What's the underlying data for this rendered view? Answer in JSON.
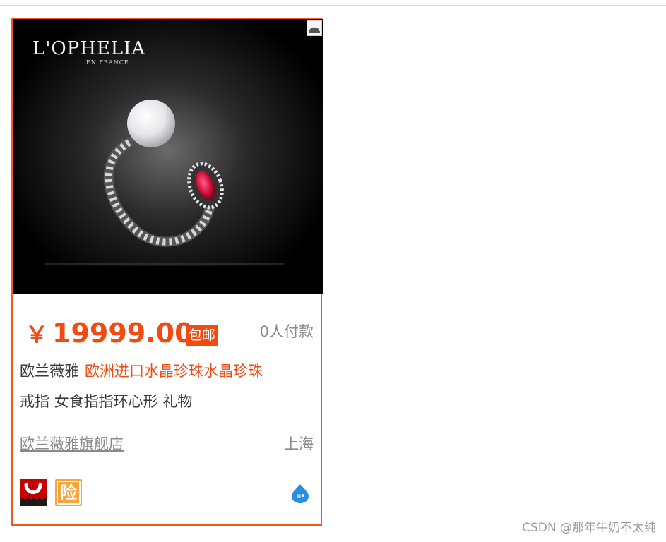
{
  "product": {
    "brand_logo_text": "L'OPHELIA",
    "brand_logo_subtext": "EN FRANCE",
    "price_currency": "￥",
    "price_value": "19999.00",
    "free_shipping_label": "包邮",
    "buyers_text": "0人付款",
    "title_brand": "欧兰薇雅",
    "title_highlight": "欧洲进口水晶珍珠水晶珍珠",
    "title_rest": "戒指 女食指指环心形 礼物",
    "shop_name": "欧兰薇雅旗舰店",
    "location": "上海"
  },
  "badges": {
    "tmall_icon": "tmall-icon",
    "insurance_icon": "insurance-icon",
    "insurance_char": "险",
    "wangwang_icon": "wangwang-chat-icon"
  },
  "footer": {
    "watermark": "CSDN @那年牛奶不太纯"
  },
  "colors": {
    "accent": "#f24a10",
    "border": "#f05a1e",
    "muted_text": "#8a8a8a"
  }
}
